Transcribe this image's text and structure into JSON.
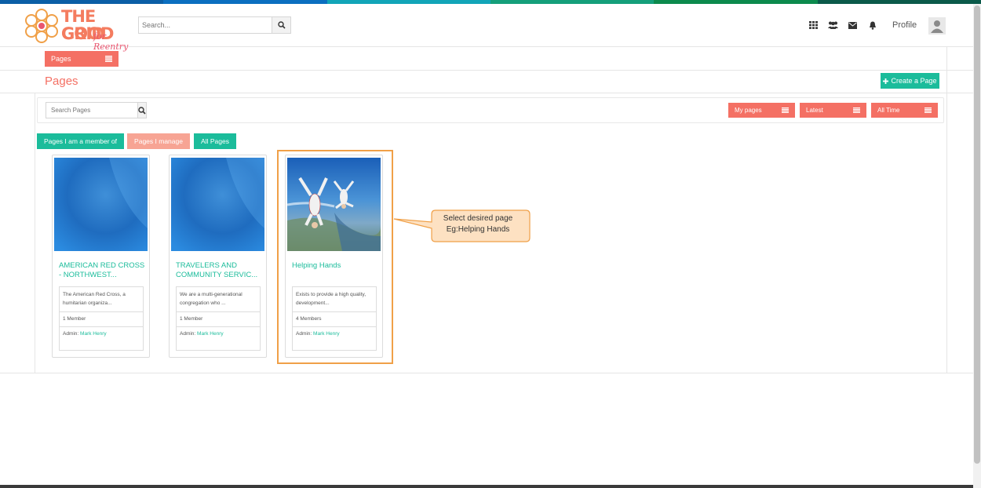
{
  "colors": {
    "top_bar": [
      "#0b5fa6",
      "#0b6fc0",
      "#12a5b8",
      "#159f7a",
      "#0c8a4d",
      "#0b5a4a"
    ],
    "accent_coral": "#f47064",
    "accent_teal": "#1bbc9b",
    "tab_pale_coral": "#f7a494",
    "highlight": "#f0a048",
    "callout_fill": "#fde1c2"
  },
  "logo": {
    "line1": "THE GOOD",
    "line2": "GRID",
    "tagline": "for Reentry"
  },
  "header": {
    "search_placeholder": "Search...",
    "search_icon": "search-icon",
    "icons": [
      "grid-icon",
      "users-icon",
      "envelope-icon",
      "bell-icon"
    ],
    "profile_label": "Profile",
    "avatar_icon": "user-icon"
  },
  "pages_menu": {
    "label": "Pages",
    "icon": "list-icon"
  },
  "page_title": "Pages",
  "create_button": {
    "label": "Create a Page",
    "icon": "plus-icon"
  },
  "filters": {
    "search_placeholder": "Search Pages",
    "dropdowns": [
      "My pages",
      "Latest",
      "All Time"
    ]
  },
  "tabs": [
    {
      "label": "Pages I am a member of",
      "color": "#1bbc9b"
    },
    {
      "label": "Pages I manage",
      "color": "#f7a494"
    },
    {
      "label": "All Pages",
      "color": "#1bbc9b"
    }
  ],
  "cards": [
    {
      "title": "AMERICAN RED CROSS - NORTHWEST...",
      "description": "The American Red Cross, a humitarian organiza...",
      "members": "1 Member",
      "admin_label": "Admin:",
      "admin_name": "Mark Henry",
      "image": "blue-gradient-placeholder"
    },
    {
      "title": "TRAVELERS AND COMMUNITY SERVIC...",
      "description": "We are a multi-generational congregation who ...",
      "members": "1 Member",
      "admin_label": "Admin:",
      "admin_name": "Mark Henry",
      "image": "blue-gradient-placeholder"
    },
    {
      "title": "Helping Hands",
      "description": "Exists to provide a high quality, development...",
      "members": "4 Members",
      "admin_label": "Admin:",
      "admin_name": "Mark Henry",
      "image": "skydivers-photo"
    }
  ],
  "callout": {
    "line1": "Select desired page",
    "line2": "Eg:Helping Hands"
  }
}
